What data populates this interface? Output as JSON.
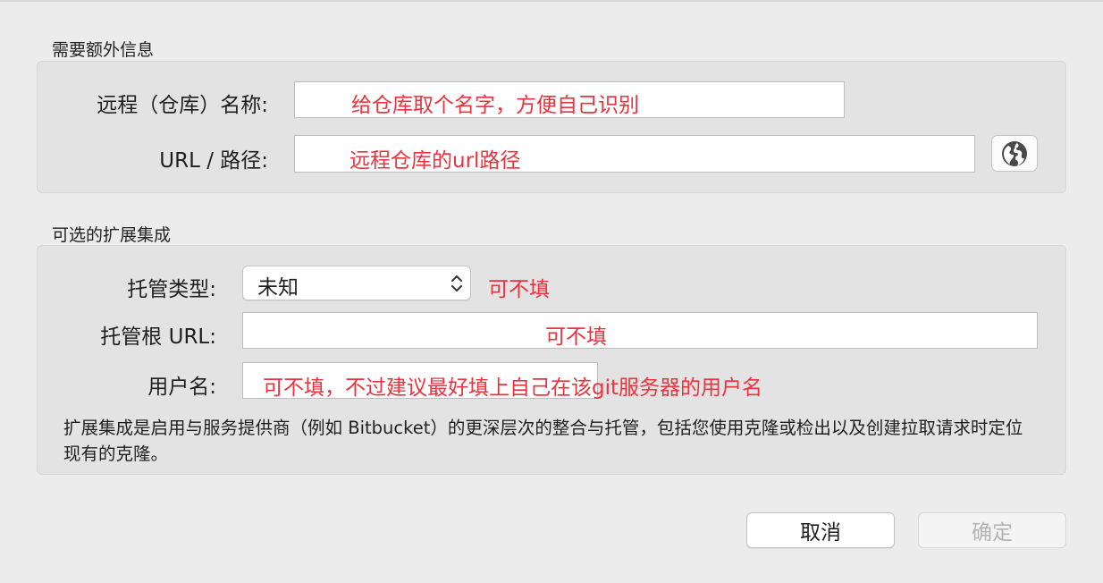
{
  "required_section": {
    "title": "需要额外信息",
    "remote_name_label": "远程（仓库）名称:",
    "remote_name_value": "",
    "url_label": "URL / 路径:",
    "url_value": ""
  },
  "optional_section": {
    "title": "可选的扩展集成",
    "hosting_type_label": "托管类型:",
    "hosting_type_value": "未知",
    "hosting_root_label": "托管根 URL:",
    "hosting_root_value": "",
    "username_label": "用户名:",
    "username_value": "",
    "description": "扩展集成是启用与服务提供商（例如 Bitbucket）的更深层次的整合与托管，包括您使用克隆或检出以及创建拉取请求时定位现有的克隆。"
  },
  "annotations": {
    "remote_name": "给仓库取个名字，方便自己识别",
    "url": "远程仓库的url路径",
    "hosting_type": "可不填",
    "hosting_root": "可不填",
    "username": "可不填，不过建议最好填上自己在该git服务器的用户名",
    "color": "#e8343f"
  },
  "buttons": {
    "cancel": "取消",
    "ok": "确定"
  },
  "icons": {
    "browse": "globe-icon",
    "select": "chevron-updown-icon"
  }
}
